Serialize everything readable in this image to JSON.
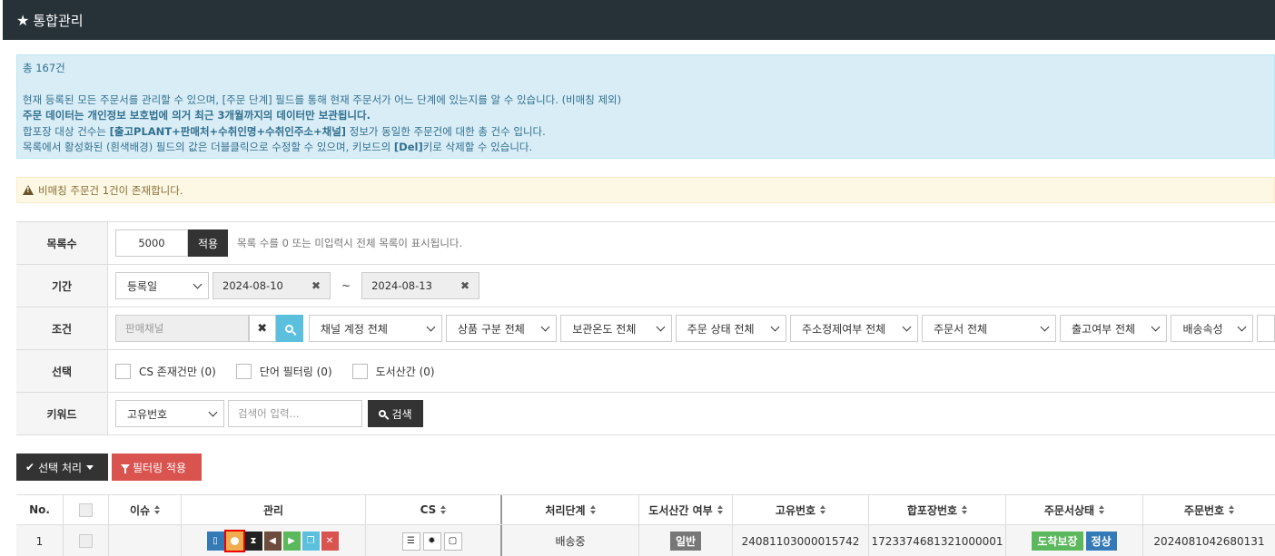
{
  "header": {
    "title": "통합관리",
    "icon": "star-icon"
  },
  "info": {
    "total": "총 167건",
    "line1": "현재 등록된 모든 주문서를 관리할 수 있으며, [주문 단계] 필드를 통해 현재 주문서가 어느 단계에 있는지를 알 수 있습니다. (비매칭 제외)",
    "line2": "주문 데이터는 개인정보 보호법에 의거 최근 3개월까지의 데이터만 보관됩니다.",
    "line3_prefix": "합포장 대상 건수는 ",
    "line3_bold": "[출고PLANT+판매처+수취인명+수취인주소+채널]",
    "line3_suffix": " 정보가 동일한 주문건에 대한 총 건수 입니다.",
    "line4_prefix": "목록에서 활성화된 (흰색배경) 필드의 값은 더블클릭으로 수정할 수 있으며, 키보드의 ",
    "line4_bold": "[Del]",
    "line4_suffix": "키로 삭제할 수 있습니다."
  },
  "warning": {
    "text": "비매칭 주문건 1건이 존재합니다.",
    "icon": "warning-icon"
  },
  "filters": {
    "list_count": {
      "label": "목록수",
      "value": "5000",
      "apply": "적용",
      "hint": "목록 수를 0 또는 미입력시 전체 목록이 표시됩니다."
    },
    "period": {
      "label": "기간",
      "type": "등록일",
      "from": "2024-08-10",
      "to": "2024-08-13",
      "tilde": "~"
    },
    "condition": {
      "label": "조건",
      "channel_placeholder": "판매채널",
      "selects": [
        "채널 계정 전체",
        "상품 구분 전체",
        "보관온도 전체",
        "주문 상태 전체",
        "주소정제여부 전체",
        "주문서 전체",
        "출고여부 전체",
        "배송속성"
      ]
    },
    "select": {
      "label": "선택",
      "options": [
        "CS 존재건만 (0)",
        "단어 필터링 (0)",
        "도서산간 (0)"
      ]
    },
    "keyword": {
      "label": "키워드",
      "field": "고유번호",
      "placeholder": "검색어 입력...",
      "search": "검색"
    }
  },
  "actions": {
    "bulk": "선택 처리",
    "filter": "필터링 적용"
  },
  "table": {
    "headers": [
      "No.",
      "",
      "이슈",
      "관리",
      "CS",
      "처리단계",
      "도서산간 여부",
      "고유번호",
      "합포장번호",
      "주문서상태",
      "주문번호"
    ],
    "rows": [
      {
        "no": "1",
        "stage": "배송중",
        "island": "일반",
        "unique": "24081103000015742",
        "pack": "1723374681321000001",
        "status1": "도착보장",
        "status2": "정상",
        "order": "2024081042680131"
      }
    ]
  },
  "colors": {
    "topbar": "#273238",
    "info_bg": "#d9edf7",
    "warn_bg": "#fcf8e3",
    "danger": "#d9534f",
    "success": "#5cb85c",
    "primary": "#337ab7"
  }
}
